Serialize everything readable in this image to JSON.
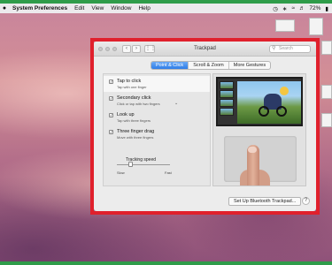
{
  "menubar": {
    "app_name": "System Preferences",
    "menus": [
      "Edit",
      "View",
      "Window",
      "Help"
    ],
    "battery": "72%",
    "apple_glyph": ""
  },
  "window": {
    "title": "Trackpad",
    "search_placeholder": "Search",
    "tabs": [
      "Point & Click",
      "Scroll & Zoom",
      "More Gestures"
    ],
    "active_tab": "Point & Click",
    "options": [
      {
        "title": "Tap to click",
        "subtitle": "Tap with one finger",
        "checked": true
      },
      {
        "title": "Secondary click",
        "subtitle": "Click or tap with two fingers",
        "checked": true
      },
      {
        "title": "Look up",
        "subtitle": "Tap with three fingers",
        "checked": true
      },
      {
        "title": "Three finger drag",
        "subtitle": "Move with three fingers",
        "checked": true
      }
    ],
    "tracking_speed": {
      "label": "Tracking speed",
      "min_label": "Slow",
      "max_label": "Fast",
      "level": 0.25
    },
    "setup_button": "Set Up Bluetooth Trackpad...",
    "help": "?"
  },
  "colors": {
    "highlight": "#e0202c",
    "tab_active": "#2f7ee8",
    "frame": "#2f9c4a"
  }
}
